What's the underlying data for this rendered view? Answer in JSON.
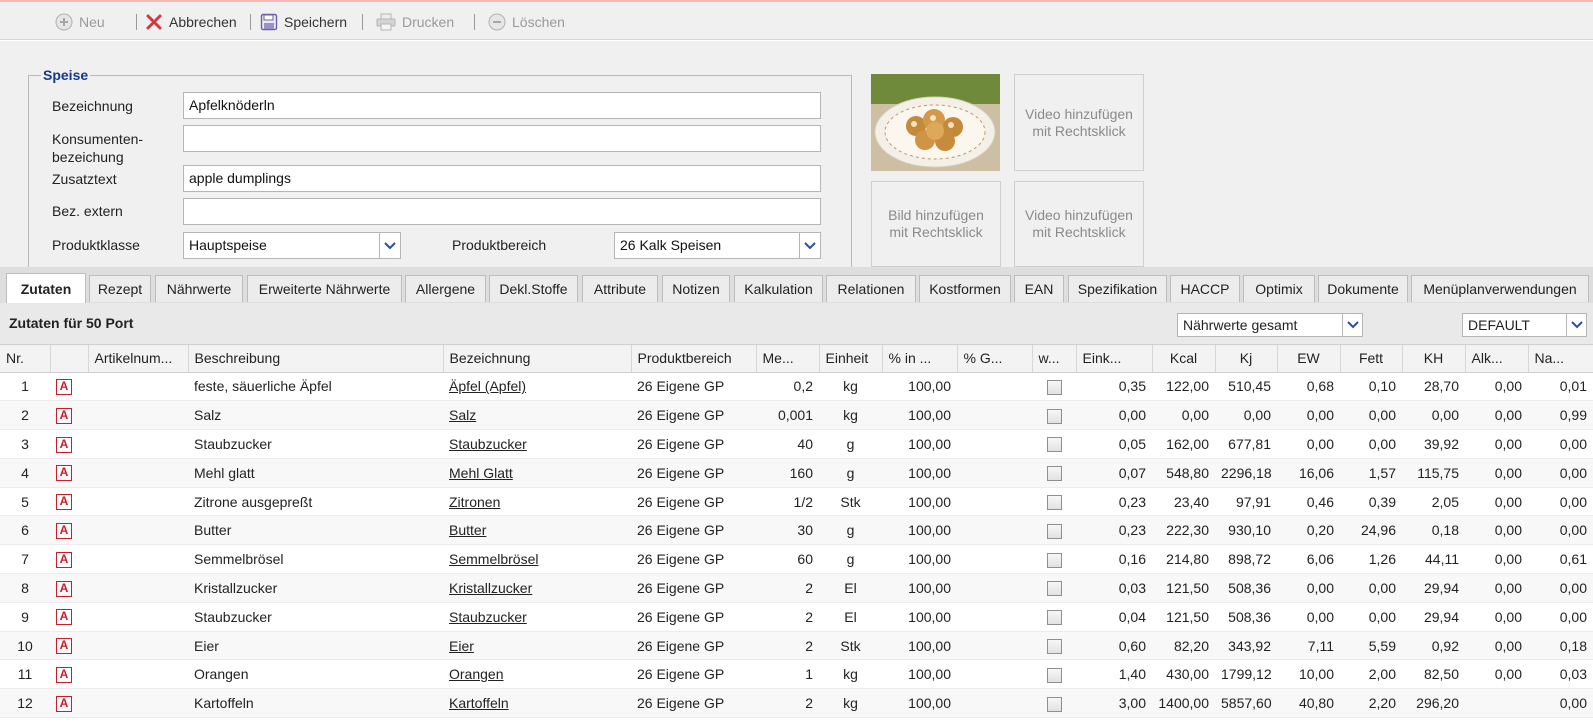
{
  "toolbar": {
    "new_label": "Neu",
    "cancel_label": "Abbrechen",
    "save_label": "Speichern",
    "print_label": "Drucken",
    "delete_label": "Löschen"
  },
  "form": {
    "legend": "Speise",
    "bezeichnung_label": "Bezeichnung",
    "bezeichnung_value": "Apfelknöderln",
    "konsument_label_1": "Konsumenten-",
    "konsument_label_2": "bezeichung",
    "konsument_value": "",
    "zusatztext_label": "Zusatztext",
    "zusatztext_value": "apple dumplings",
    "bezextern_label": "Bez. extern",
    "bezextern_value": "",
    "produktklasse_label": "Produktklasse",
    "produktklasse_value": "Hauptspeise",
    "produktbereich_label": "Produktbereich",
    "produktbereich_value": "26 Kalk Speisen"
  },
  "media": {
    "video1_line1": "Video hinzufügen",
    "video1_line2": "mit Rechtsklick",
    "bild_line1": "Bild hinzufügen",
    "bild_line2": "mit Rechtsklick",
    "video2_line1": "Video hinzufügen",
    "video2_line2": "mit Rechtsklick"
  },
  "tabs": [
    "Zutaten",
    "Rezept",
    "Nährwerte",
    "Erweiterte Nährwerte",
    "Allergene",
    "Dekl.Stoffe",
    "Attribute",
    "Notizen",
    "Kalkulation",
    "Relationen",
    "Kostformen",
    "EAN",
    "Spezifikation",
    "HACCP",
    "Optimix",
    "Dokumente",
    "Menüplanverwendungen"
  ],
  "active_tab": "Zutaten",
  "zutaten": {
    "title": "Zutaten für 50 Port",
    "naehrwerte_select": "Nährwerte gesamt",
    "profile_select": "DEFAULT"
  },
  "columns": [
    "Nr.",
    "",
    "Artikelnum...",
    "Beschreibung",
    "Bezeichnung",
    "Produktbereich",
    "Me...",
    "Einheit",
    "% in ...",
    "% G...",
    "w...",
    "Eink...",
    "Kcal",
    "Kj",
    "EW",
    "Fett",
    "KH",
    "Alk...",
    "Na..."
  ],
  "rows": [
    {
      "nr": "1",
      "beschreibung": "feste, säuerliche Äpfel",
      "bezeichnung": "Äpfel (Apfel)",
      "produktbereich": "26 Eigene GP",
      "menge": "0,2",
      "einheit": "kg",
      "pct": "100,00",
      "eink": "0,35",
      "kcal": "122,00",
      "kj": "510,45",
      "ew": "0,68",
      "fett": "0,10",
      "kh": "28,70",
      "alk": "0,00",
      "na": "0,01"
    },
    {
      "nr": "2",
      "beschreibung": "Salz",
      "bezeichnung": "Salz",
      "produktbereich": "26 Eigene GP",
      "menge": "0,001",
      "einheit": "kg",
      "pct": "100,00",
      "eink": "0,00",
      "kcal": "0,00",
      "kj": "0,00",
      "ew": "0,00",
      "fett": "0,00",
      "kh": "0,00",
      "alk": "0,00",
      "na": "0,99"
    },
    {
      "nr": "3",
      "beschreibung": "Staubzucker",
      "bezeichnung": "Staubzucker",
      "produktbereich": "26 Eigene GP",
      "menge": "40",
      "einheit": "g",
      "pct": "100,00",
      "eink": "0,05",
      "kcal": "162,00",
      "kj": "677,81",
      "ew": "0,00",
      "fett": "0,00",
      "kh": "39,92",
      "alk": "0,00",
      "na": "0,00"
    },
    {
      "nr": "4",
      "beschreibung": "Mehl glatt",
      "bezeichnung": "Mehl Glatt",
      "produktbereich": "26 Eigene GP",
      "menge": "160",
      "einheit": "g",
      "pct": "100,00",
      "eink": "0,07",
      "kcal": "548,80",
      "kj": "2296,18",
      "ew": "16,06",
      "fett": "1,57",
      "kh": "115,75",
      "alk": "0,00",
      "na": "0,00"
    },
    {
      "nr": "5",
      "beschreibung": "Zitrone ausgepreßt",
      "bezeichnung": "Zitronen",
      "produktbereich": "26 Eigene GP",
      "menge": "1/2",
      "einheit": "Stk",
      "pct": "100,00",
      "eink": "0,23",
      "kcal": "23,40",
      "kj": "97,91",
      "ew": "0,46",
      "fett": "0,39",
      "kh": "2,05",
      "alk": "0,00",
      "na": "0,00"
    },
    {
      "nr": "6",
      "beschreibung": "Butter",
      "bezeichnung": "Butter",
      "produktbereich": "26 Eigene GP",
      "menge": "30",
      "einheit": "g",
      "pct": "100,00",
      "eink": "0,23",
      "kcal": "222,30",
      "kj": "930,10",
      "ew": "0,20",
      "fett": "24,96",
      "kh": "0,18",
      "alk": "0,00",
      "na": "0,00"
    },
    {
      "nr": "7",
      "beschreibung": "Semmelbrösel",
      "bezeichnung": "Semmelbrösel",
      "produktbereich": "26 Eigene GP",
      "menge": "60",
      "einheit": "g",
      "pct": "100,00",
      "eink": "0,16",
      "kcal": "214,80",
      "kj": "898,72",
      "ew": "6,06",
      "fett": "1,26",
      "kh": "44,11",
      "alk": "0,00",
      "na": "0,61"
    },
    {
      "nr": "8",
      "beschreibung": "Kristallzucker",
      "bezeichnung": "Kristallzucker",
      "produktbereich": "26 Eigene GP",
      "menge": "2",
      "einheit": "El",
      "pct": "100,00",
      "eink": "0,03",
      "kcal": "121,50",
      "kj": "508,36",
      "ew": "0,00",
      "fett": "0,00",
      "kh": "29,94",
      "alk": "0,00",
      "na": "0,00"
    },
    {
      "nr": "9",
      "beschreibung": "Staubzucker",
      "bezeichnung": "Staubzucker",
      "produktbereich": "26 Eigene GP",
      "menge": "2",
      "einheit": "El",
      "pct": "100,00",
      "eink": "0,04",
      "kcal": "121,50",
      "kj": "508,36",
      "ew": "0,00",
      "fett": "0,00",
      "kh": "29,94",
      "alk": "0,00",
      "na": "0,00"
    },
    {
      "nr": "10",
      "beschreibung": "Eier",
      "bezeichnung": "Eier",
      "produktbereich": "26 Eigene GP",
      "menge": "2",
      "einheit": "Stk",
      "pct": "100,00",
      "eink": "0,60",
      "kcal": "82,20",
      "kj": "343,92",
      "ew": "7,11",
      "fett": "5,59",
      "kh": "0,92",
      "alk": "0,00",
      "na": "0,18"
    },
    {
      "nr": "11",
      "beschreibung": "Orangen",
      "bezeichnung": "Orangen",
      "produktbereich": "26 Eigene GP",
      "menge": "1",
      "einheit": "kg",
      "pct": "100,00",
      "eink": "1,40",
      "kcal": "430,00",
      "kj": "1799,12",
      "ew": "10,00",
      "fett": "2,00",
      "kh": "82,50",
      "alk": "0,00",
      "na": "0,03"
    },
    {
      "nr": "12",
      "beschreibung": "Kartoffeln",
      "bezeichnung": "Kartoffeln",
      "produktbereich": "26 Eigene GP",
      "menge": "2",
      "einheit": "kg",
      "pct": "100,00",
      "eink": "3,00",
      "kcal": "1400,00",
      "kj": "5857,60",
      "ew": "40,80",
      "fett": "2,20",
      "kh": "296,20",
      "alk": "",
      "na": "0,00"
    }
  ],
  "icons": {
    "row_icon_glyph": "A",
    "new": "plus-circle-icon",
    "cancel": "x-icon",
    "save": "floppy-icon",
    "print": "printer-icon",
    "delete": "minus-circle-icon"
  },
  "colors": {
    "accent_blue": "#15398a",
    "delete_red": "#d13a3a",
    "row_icon_red": "#c8202a"
  }
}
